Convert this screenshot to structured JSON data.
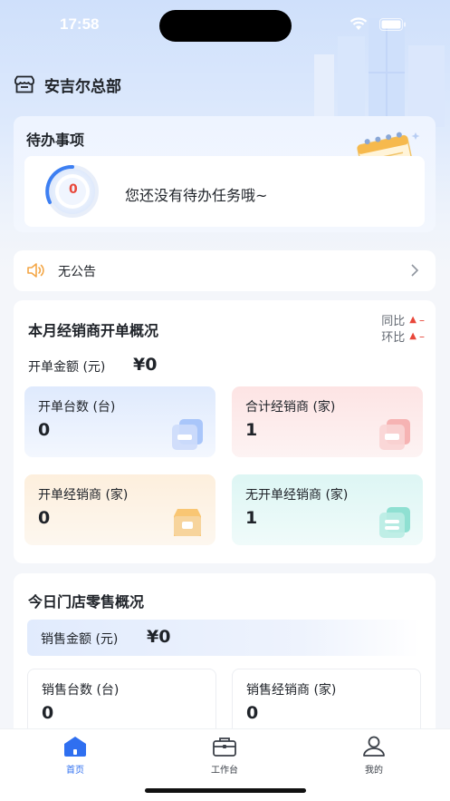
{
  "status_bar": {
    "time": "17:58"
  },
  "header": {
    "org_name": "安吉尔总部",
    "org_icon": "store-icon"
  },
  "todo": {
    "title": "待办事项",
    "count": "0",
    "empty_message": "您还没有待办任务哦~"
  },
  "notice": {
    "text": "无公告"
  },
  "dealer_overview": {
    "title": "本月经销商开单概况",
    "yoy_label": "同比",
    "mom_label": "环比",
    "trend_dash": "–",
    "amount_label": "开单金额 (元)",
    "amount_value": "¥0",
    "tiles": [
      {
        "label": "开单台数 (台)",
        "value": "0",
        "icon": "device-card-icon"
      },
      {
        "label": "合计经销商 (家)",
        "value": "1",
        "icon": "store-card-icon"
      },
      {
        "label": "开单经销商 (家)",
        "value": "0",
        "icon": "shop-icon"
      },
      {
        "label": "无开单经销商 (家)",
        "value": "1",
        "icon": "document-card-icon"
      }
    ]
  },
  "retail_overview": {
    "title": "今日门店零售概况",
    "sales_label": "销售金额 (元)",
    "sales_value": "¥0",
    "tiles": [
      {
        "label": "销售台数 (台)",
        "value": "0"
      },
      {
        "label": "销售经销商 (家)",
        "value": "0"
      }
    ]
  },
  "tabbar": {
    "items": [
      {
        "label": "首页",
        "icon": "home-icon",
        "active": true
      },
      {
        "label": "工作台",
        "icon": "briefcase-icon",
        "active": false
      },
      {
        "label": "我的",
        "icon": "user-icon",
        "active": false
      }
    ]
  },
  "colors": {
    "accent": "#2f6ff0",
    "trend_up": "#e8473a",
    "tile_blue": "#dfeafd",
    "tile_red": "#fde4e4",
    "tile_orange": "#fdefdd",
    "tile_teal": "#ddf6f4"
  }
}
